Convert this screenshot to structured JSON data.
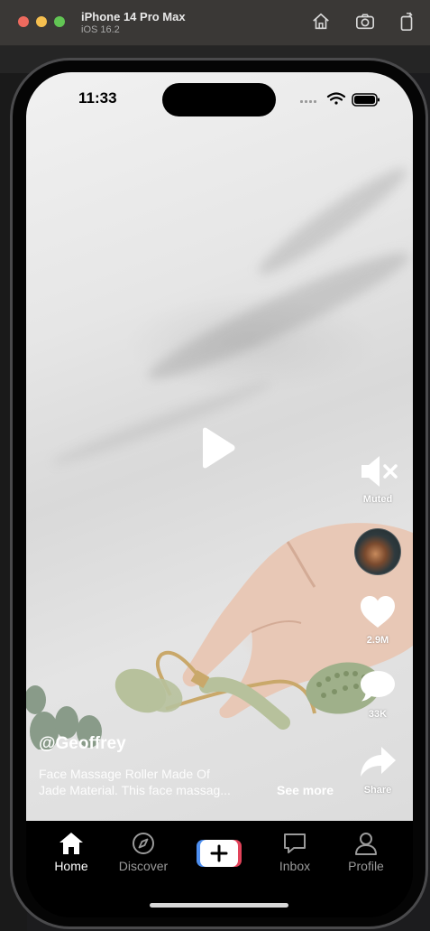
{
  "simulator": {
    "device_name": "iPhone 14 Pro Max",
    "os_version": "iOS 16.2",
    "icons": [
      "home-icon",
      "screenshot-icon",
      "rotate-icon"
    ]
  },
  "status_bar": {
    "time": "11:33",
    "icons": [
      "signal-icon",
      "wifi-icon",
      "battery-icon"
    ]
  },
  "video": {
    "overlay_icon": "play-icon",
    "username": "@Geoffrey",
    "description_line1": "Face Massage Roller Made Of",
    "description_line2": "Jade Material. This face massag...",
    "see_more": "See more"
  },
  "actions": {
    "mute_label": "Muted",
    "likes": "2.9M",
    "comments": "33K",
    "share_label": "Share"
  },
  "tabbar": {
    "tabs": [
      {
        "label": "Home",
        "icon": "home-icon",
        "active": true
      },
      {
        "label": "Discover",
        "icon": "compass-icon",
        "active": false
      },
      {
        "label": "",
        "icon": "plus-icon",
        "active": false
      },
      {
        "label": "Inbox",
        "icon": "message-icon",
        "active": false
      },
      {
        "label": "Profile",
        "icon": "user-icon",
        "active": false
      }
    ]
  },
  "colors": {
    "create_left": "#4e8ff0",
    "create_right": "#e2435a",
    "tab_active": "#ffffff",
    "tab_inactive": "#9a9a9a"
  }
}
